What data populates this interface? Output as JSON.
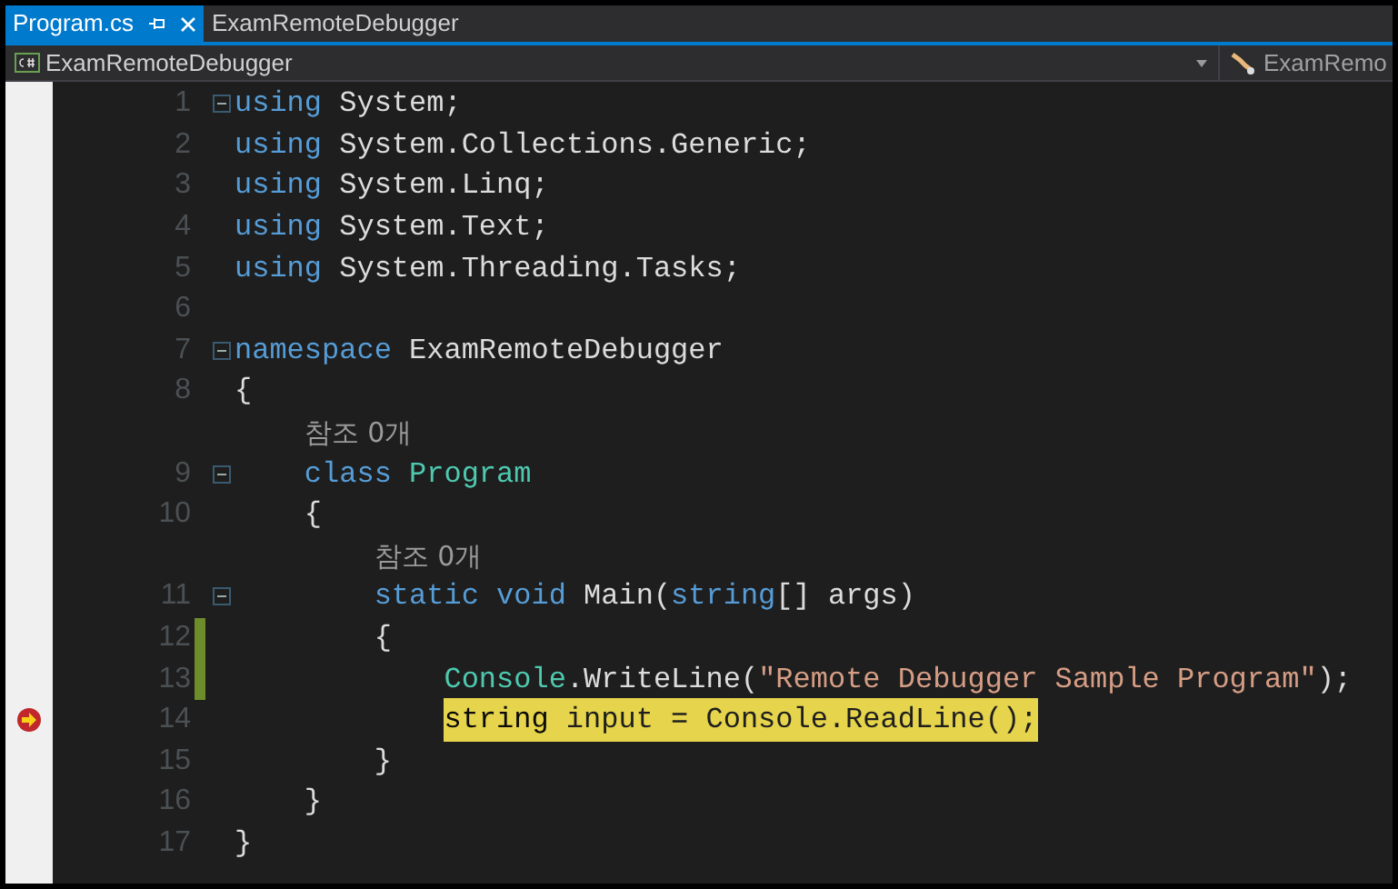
{
  "tabs": [
    {
      "label": "Program.cs",
      "selected": true
    },
    {
      "label": "ExamRemoteDebugger",
      "selected": false
    }
  ],
  "navigation_bar": {
    "project": "ExamRemoteDebugger",
    "member": "ExamRemo"
  },
  "editor": {
    "lines": [
      {
        "kind": "code",
        "number": "1",
        "collapsible": true,
        "changed": false,
        "current": false,
        "tokens": [
          {
            "kind": "keyword",
            "text": "using"
          },
          {
            "kind": "plain",
            "text": " System;"
          }
        ]
      },
      {
        "kind": "code",
        "number": "2",
        "collapsible": false,
        "changed": false,
        "current": false,
        "tokens": [
          {
            "kind": "keyword",
            "text": "using"
          },
          {
            "kind": "plain",
            "text": " System.Collections.Generic;"
          }
        ]
      },
      {
        "kind": "code",
        "number": "3",
        "collapsible": false,
        "changed": false,
        "current": false,
        "tokens": [
          {
            "kind": "keyword",
            "text": "using"
          },
          {
            "kind": "plain",
            "text": " System.Linq;"
          }
        ]
      },
      {
        "kind": "code",
        "number": "4",
        "collapsible": false,
        "changed": false,
        "current": false,
        "tokens": [
          {
            "kind": "keyword",
            "text": "using"
          },
          {
            "kind": "plain",
            "text": " System.Text;"
          }
        ]
      },
      {
        "kind": "code",
        "number": "5",
        "collapsible": false,
        "changed": false,
        "current": false,
        "tokens": [
          {
            "kind": "keyword",
            "text": "using"
          },
          {
            "kind": "plain",
            "text": " System.Threading.Tasks;"
          }
        ]
      },
      {
        "kind": "code",
        "number": "6",
        "collapsible": false,
        "changed": false,
        "current": false
      },
      {
        "kind": "code",
        "number": "7",
        "collapsible": true,
        "changed": false,
        "current": false,
        "tokens": [
          {
            "kind": "keyword",
            "text": "namespace"
          },
          {
            "kind": "plain",
            "text": " ExamRemoteDebugger"
          }
        ]
      },
      {
        "kind": "code",
        "number": "8",
        "collapsible": false,
        "changed": false,
        "current": false,
        "tokens": [
          {
            "kind": "plain",
            "text": "{"
          }
        ]
      },
      {
        "kind": "codelens",
        "text": "    참조 0개"
      },
      {
        "kind": "code",
        "number": "9",
        "collapsible": true,
        "changed": false,
        "current": false,
        "tokens": [
          {
            "kind": "keyword",
            "text": "    class"
          },
          {
            "kind": "type",
            "text": " Program"
          }
        ]
      },
      {
        "kind": "code",
        "number": "10",
        "collapsible": false,
        "changed": false,
        "current": false,
        "tokens": [
          {
            "kind": "plain",
            "text": "    {"
          }
        ]
      },
      {
        "kind": "codelens",
        "text": "        참조 0개"
      },
      {
        "kind": "code",
        "number": "11",
        "collapsible": true,
        "changed": false,
        "current": false,
        "tokens": [
          {
            "kind": "keyword",
            "text": "        static void"
          },
          {
            "kind": "plain",
            "text": " Main("
          },
          {
            "kind": "keyword",
            "text": "string"
          },
          {
            "kind": "plain",
            "text": "[] args)"
          }
        ]
      },
      {
        "kind": "code",
        "number": "12",
        "collapsible": false,
        "changed": true,
        "current": false,
        "tokens": [
          {
            "kind": "plain",
            "text": "        {"
          }
        ]
      },
      {
        "kind": "code",
        "number": "13",
        "collapsible": false,
        "changed": true,
        "current": false,
        "tokens": [
          {
            "kind": "type",
            "text": "            Console"
          },
          {
            "kind": "plain",
            "text": ".WriteLine("
          },
          {
            "kind": "string",
            "text": "\"Remote Debugger Sample Program\""
          },
          {
            "kind": "plain",
            "text": ");"
          }
        ]
      },
      {
        "kind": "code",
        "number": "14",
        "collapsible": false,
        "changed": false,
        "current": true,
        "tokens": [
          {
            "kind": "keyword",
            "text": "            string"
          },
          {
            "kind": "plain",
            "text": " input = Console.ReadLine();"
          }
        ]
      },
      {
        "kind": "code",
        "number": "15",
        "collapsible": false,
        "changed": false,
        "current": false,
        "tokens": [
          {
            "kind": "plain",
            "text": "        }"
          }
        ]
      },
      {
        "kind": "code",
        "number": "16",
        "collapsible": false,
        "changed": false,
        "current": false,
        "tokens": [
          {
            "kind": "plain",
            "text": "    }"
          }
        ]
      },
      {
        "kind": "code",
        "number": "17",
        "collapsible": false,
        "changed": false,
        "current": false,
        "tokens": [
          {
            "kind": "plain",
            "text": "}"
          }
        ]
      }
    ]
  }
}
